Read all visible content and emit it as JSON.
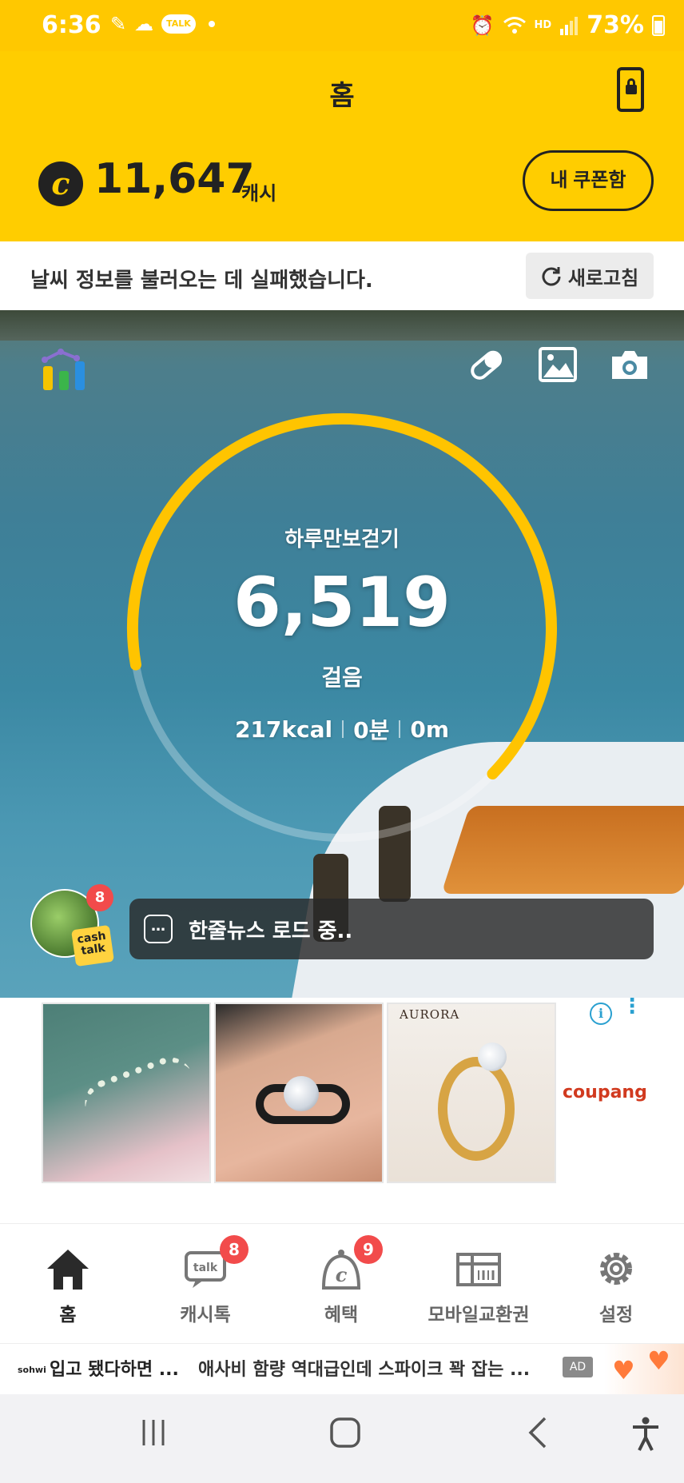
{
  "status_bar": {
    "time": "6:36",
    "talk_label": "TALK",
    "network_label": "HD",
    "battery_percent": "73%"
  },
  "header": {
    "title": "홈",
    "cash_amount": "11,647",
    "cash_unit": "캐시",
    "coupon_button": "내 쿠폰함"
  },
  "weather": {
    "message": "날씨 정보를 불러오는 데 실패했습니다.",
    "refresh_label": "새로고침"
  },
  "steps": {
    "title": "하루만보걷기",
    "count": "6,519",
    "unit": "걸음",
    "kcal": "217kcal",
    "minutes": "0분",
    "distance": "0m",
    "progress_fraction": 0.65
  },
  "news": {
    "badge": "8",
    "avatar_label": "cash talk",
    "text": "한줄뉴스 로드 중.."
  },
  "ads": {
    "brand_label": "AURORA",
    "advertiser": "coupang",
    "info_symbol": "i"
  },
  "bottom_nav": {
    "items": [
      {
        "label": "홈",
        "icon": "home-icon"
      },
      {
        "label": "캐시톡",
        "icon": "talk-icon",
        "badge": "8"
      },
      {
        "label": "혜택",
        "icon": "benefit-icon",
        "badge": "9"
      },
      {
        "label": "모바일교환권",
        "icon": "gift-card-icon"
      },
      {
        "label": "설정",
        "icon": "gear-icon"
      }
    ]
  },
  "ad_banner": {
    "brand": "sohwi",
    "title": "입고 됐다하면 ...",
    "description": "애사비 함량 역대급인데 스파이크 꽉 잡는 ...",
    "tag": "AD"
  },
  "colors": {
    "brand_yellow": "#ffcd00",
    "ring_yellow": "#ffc400",
    "badge_red": "#f24b4b"
  }
}
